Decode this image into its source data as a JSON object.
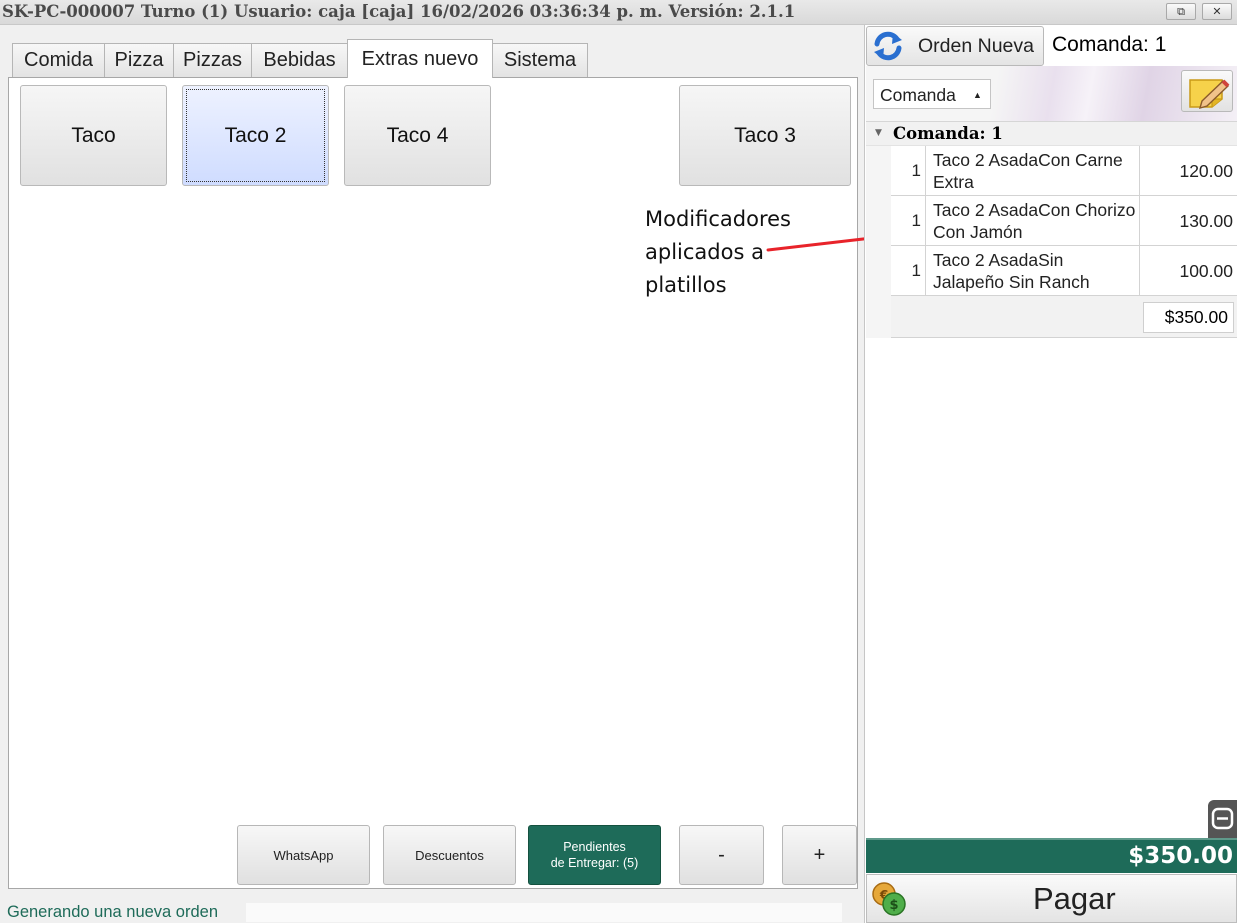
{
  "window": {
    "title": "SK-PC-000007 Turno (1) Usuario: caja [caja] 16/02/2026 03:36:34 p. m. Versión: 2.1.1",
    "restore_glyph": "⧉",
    "close_glyph": "✕"
  },
  "tabs": [
    {
      "label": "Comida"
    },
    {
      "label": "Pizza"
    },
    {
      "label": "Pizzas"
    },
    {
      "label": "Bebidas"
    },
    {
      "label": "Extras nuevo",
      "active": true
    },
    {
      "label": "Sistema"
    }
  ],
  "products": [
    {
      "label": "Taco"
    },
    {
      "label": "Taco 2",
      "selected": true
    },
    {
      "label": "Taco 4"
    },
    {
      "label": "Taco 3"
    }
  ],
  "annotation": {
    "line1": "Modificadores",
    "line2": "aplicados a",
    "line3": "platillos",
    "arrow_color": "#e8232a"
  },
  "bottom_buttons": {
    "whatsapp": "WhatsApp",
    "descuentos": "Descuentos",
    "pendientes_line1": "Pendientes",
    "pendientes_line2": "de Entregar: (5)",
    "minus": "-",
    "plus": "+"
  },
  "status": {
    "text": "Generando una nueva orden"
  },
  "order_panel": {
    "new_order_label": "Orden Nueva",
    "comanda_title": "Comanda: 1",
    "dropdown_value": "Comanda",
    "group_label": "Comanda: 1",
    "items": [
      {
        "qty": "1",
        "line1": "Taco 2 AsadaCon Carne",
        "line2": "Extra",
        "price": "120.00"
      },
      {
        "qty": "1",
        "line1": "Taco 2 AsadaCon Chorizo",
        "line2": "Con Jamón",
        "price": "130.00"
      },
      {
        "qty": "1",
        "line1": "Taco 2 AsadaSin",
        "line2": "Jalapeño Sin Ranch",
        "price": "100.00"
      }
    ],
    "subtotal": "$350.00",
    "total": "$350.00",
    "pay_label": "Pagar"
  },
  "colors": {
    "accent_green": "#1e6b59",
    "refresh_blue": "#2a6fd0",
    "annotation_red": "#e8232a"
  }
}
